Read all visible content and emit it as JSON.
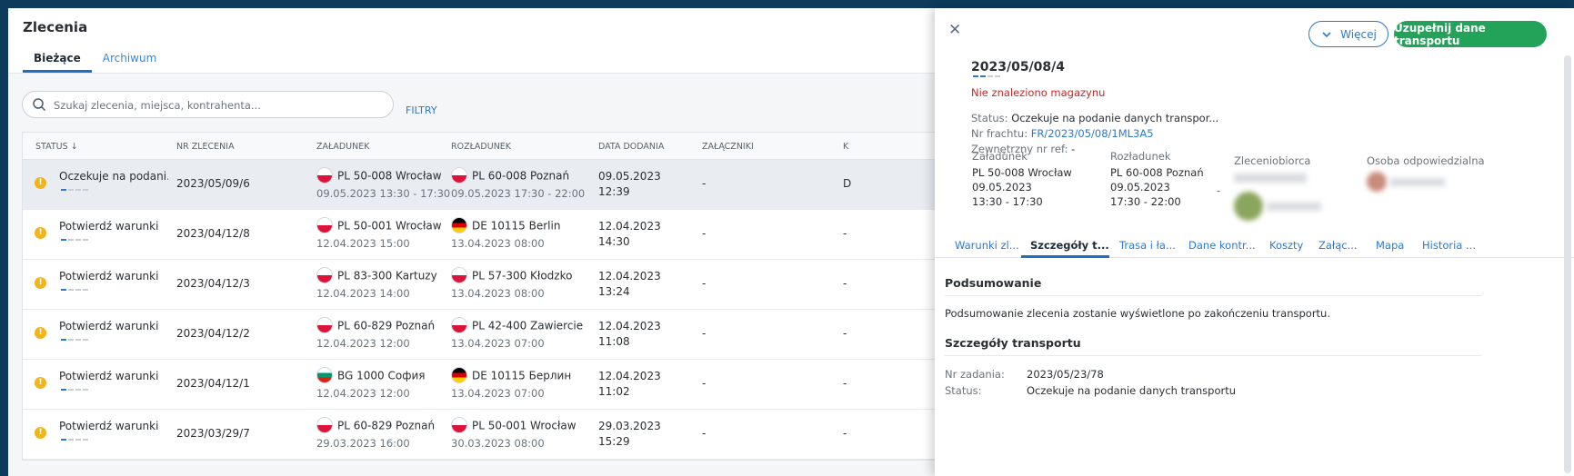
{
  "page": {
    "title": "Zlecenia",
    "tabs": [
      {
        "label": "Bieżące",
        "active": true
      },
      {
        "label": "Archiwum",
        "active": false
      }
    ]
  },
  "search": {
    "placeholder": "Szukaj zlecenia, miejsca, kontrahenta...",
    "filters_label": "FILTRY"
  },
  "table": {
    "headers": [
      "STATUS",
      "NR ZLECENIA",
      "ZAŁADUNEK",
      "ROZŁADUNEK",
      "DATA DODANIA",
      "ZAŁĄCZNIKI",
      "K"
    ],
    "sort_icon": "arrow-down-icon",
    "rows": [
      {
        "status": "Oczekuje na podani...",
        "nr": "2023/05/09/6",
        "load_flag": "pl",
        "load_place": "PL 50-008 Wrocław",
        "load_date": "09.05.2023 13:30 - 17:30",
        "unload_flag": "pl",
        "unload_place": "PL 60-008 Poznań",
        "unload_date": "09.05.2023 17:30 - 22:00",
        "added_date": "09.05.2023",
        "added_time": "12:39",
        "attachments": "-",
        "last": "D",
        "selected": true
      },
      {
        "status": "Potwierdź warunki",
        "nr": "2023/04/12/8",
        "load_flag": "pl",
        "load_place": "PL 50-001 Wrocław",
        "load_date": "12.04.2023 15:00",
        "unload_flag": "de",
        "unload_place": "DE 10115 Berlin",
        "unload_date": "13.04.2023 08:00",
        "added_date": "12.04.2023",
        "added_time": "14:30",
        "attachments": "-",
        "last": "-",
        "selected": false
      },
      {
        "status": "Potwierdź warunki",
        "nr": "2023/04/12/3",
        "load_flag": "pl",
        "load_place": "PL 83-300 Kartuzy",
        "load_date": "12.04.2023 14:00",
        "unload_flag": "pl",
        "unload_place": "PL 57-300 Kłodzko",
        "unload_date": "13.04.2023 08:00",
        "added_date": "12.04.2023",
        "added_time": "13:24",
        "attachments": "-",
        "last": "-",
        "selected": false
      },
      {
        "status": "Potwierdź warunki",
        "nr": "2023/04/12/2",
        "load_flag": "pl",
        "load_place": "PL 60-829 Poznań",
        "load_date": "12.04.2023 12:00",
        "unload_flag": "pl",
        "unload_place": "PL 42-400 Zawiercie",
        "unload_date": "13.04.2023 07:00",
        "added_date": "12.04.2023",
        "added_time": "11:08",
        "attachments": "-",
        "last": "-",
        "selected": false
      },
      {
        "status": "Potwierdź warunki",
        "nr": "2023/04/12/1",
        "load_flag": "bg",
        "load_place": "BG 1000 София",
        "load_date": "12.04.2023 12:00",
        "unload_flag": "de",
        "unload_place": "DE 10115 Берлин",
        "unload_date": "13.04.2023 07:00",
        "added_date": "12.04.2023",
        "added_time": "11:02",
        "attachments": "-",
        "last": "-",
        "selected": false
      },
      {
        "status": "Potwierdź warunki",
        "nr": "2023/03/29/7",
        "load_flag": "pl",
        "load_place": "PL 60-829 Poznań",
        "load_date": "29.03.2023 16:00",
        "unload_flag": "pl",
        "unload_place": "PL 50-001 Wrocław",
        "unload_date": "30.03.2023 08:00",
        "added_date": "29.03.2023",
        "added_time": "15:29",
        "attachments": "-",
        "last": "-",
        "selected": false
      }
    ]
  },
  "panel": {
    "more_label": "Więcej",
    "fill_label": "Uzupełnij dane transportu",
    "order_no": "2023/05/08/4",
    "warning": "Nie znaleziono magazynu",
    "status_label": "Status:",
    "status_value": "Oczekuje na podanie danych transpor...",
    "freight_label": "Nr frachtu:",
    "freight_value": "FR/2023/05/08/1ML3A5",
    "extref_label": "Zewnętrzny nr ref:",
    "extref_value": "-",
    "load": {
      "label": "Załadunek",
      "place": "PL 50-008 Wrocław",
      "date": "09.05.2023",
      "time": "13:30 - 17:30"
    },
    "unload": {
      "label": "Rozładunek",
      "place": "PL 60-008 Poznań",
      "date": "09.05.2023",
      "time": "17:30 - 22:00"
    },
    "separator": "-",
    "contractor_label": "Zleceniobiorca",
    "responsible_label": "Osoba odpowiedzialna",
    "tabs": [
      "Warunki zl...",
      "Szczegóły t...",
      "Trasa i ła...",
      "Dane kontr...",
      "Koszty",
      "Załąc...",
      "Mapa",
      "Historia ..."
    ],
    "active_tab": 1,
    "summary_title": "Podsumowanie",
    "summary_text": "Podsumowanie zlecenia zostanie wyświetlone po zakończeniu transportu.",
    "details_title": "Szczegóły transportu",
    "task_label": "Nr zadania:",
    "task_value": "2023/05/23/78",
    "detail_status_label": "Status:",
    "detail_status_value": "Oczekuje na podanie danych transportu"
  }
}
